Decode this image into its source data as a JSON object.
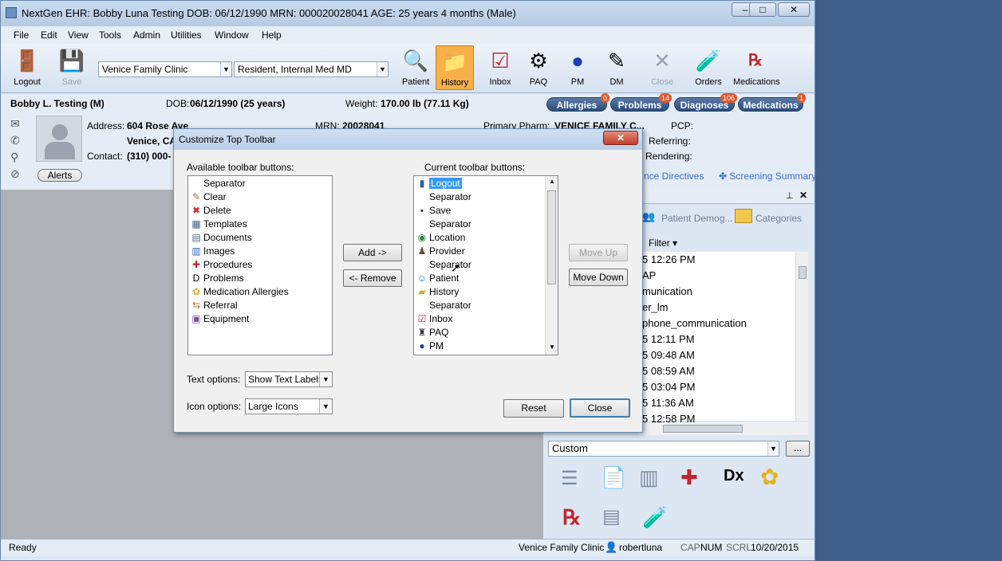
{
  "window": {
    "title": "NextGen EHR: Bobby Luna Testing  DOB: 06/12/1990  MRN: 000020028041  AGE: 25 years 4 months  (Male)",
    "controls": [
      "–",
      "□",
      "✕"
    ]
  },
  "menu": [
    "File",
    "Edit",
    "View",
    "Tools",
    "Admin",
    "Utilities",
    "Window",
    "Help"
  ],
  "toolbar": {
    "logout": "Logout",
    "save": "Save",
    "location_value": "Venice Family Clinic",
    "provider_value": "Resident, Internal Med MD",
    "patient": "Patient",
    "history": "History",
    "inbox": "Inbox",
    "paq": "PAQ",
    "pm": "PM",
    "dm": "DM",
    "close": "Close",
    "orders": "Orders",
    "medications": "Medications"
  },
  "patient": {
    "name": "Bobby L. Testing  (M)",
    "dob_label": "DOB:",
    "dob_value": "06/12/1990 (25 years)",
    "weight_label": "Weight:",
    "weight_value": "170.00 lb (77.11 Kg)",
    "address_label": "Address:",
    "address_value": "604 Rose Ave",
    "city_value": "Venice, CA",
    "contact_label": "Contact:",
    "contact_value": "(310) 000-",
    "mrn_label": "MRN:",
    "mrn_value": "20028041",
    "pharm_label": "Primary Pharm:",
    "pharm_value": "VENICE FAMILY C...",
    "pcp_label": "PCP:",
    "referring_label": "Referring:",
    "rendering_label": "Rendering:",
    "alerts": "Alerts"
  },
  "pills": [
    {
      "label": "Allergies",
      "badge": "0"
    },
    {
      "label": "Problems",
      "badge": "14"
    },
    {
      "label": "Diagnoses",
      "badge": "106"
    },
    {
      "label": "Medications",
      "badge": "1"
    }
  ],
  "right_panel": {
    "links": [
      "nce Directives",
      "Screening Summary"
    ],
    "tabs": [
      "Patient Demog...",
      "Categories"
    ],
    "filter": "Filter",
    "list": [
      "5 12:26 PM",
      "AP",
      "munication",
      "er_lm",
      "phone_communication",
      "5 12:11 PM",
      "5 09:48 AM",
      "5 08:59 AM",
      "5 03:04 PM",
      "5 11:36 AM",
      "5 12:58 PM"
    ],
    "custom": "Custom",
    "more": "..."
  },
  "dialog": {
    "title": "Customize Top Toolbar",
    "close": "✕",
    "available_label": "Available toolbar buttons:",
    "current_label": "Current toolbar buttons:",
    "available": [
      {
        "icon": "",
        "label": "Separator"
      },
      {
        "icon": "eraser-icon",
        "label": "Clear"
      },
      {
        "icon": "x-icon",
        "label": "Delete"
      },
      {
        "icon": "table-icon",
        "label": "Templates"
      },
      {
        "icon": "document-icon",
        "label": "Documents"
      },
      {
        "icon": "images-icon",
        "label": "Images"
      },
      {
        "icon": "procedures-icon",
        "label": "Procedures"
      },
      {
        "icon": "dx-icon",
        "label": "Problems"
      },
      {
        "icon": "flower-icon",
        "label": "Medication Allergies"
      },
      {
        "icon": "referral-icon",
        "label": "Referral"
      },
      {
        "icon": "equipment-icon",
        "label": "Equipment"
      }
    ],
    "current": [
      {
        "icon": "logout-icon",
        "label": "Logout",
        "selected": true
      },
      {
        "icon": "",
        "label": "Separator"
      },
      {
        "icon": "floppy-icon",
        "label": "Save"
      },
      {
        "icon": "",
        "label": "Separator"
      },
      {
        "icon": "globe-icon",
        "label": "Location"
      },
      {
        "icon": "doctor-icon",
        "label": "Provider"
      },
      {
        "icon": "",
        "label": "Separator"
      },
      {
        "icon": "patient-icon",
        "label": "Patient"
      },
      {
        "icon": "history-icon",
        "label": "History"
      },
      {
        "icon": "",
        "label": "Separator"
      },
      {
        "icon": "check-icon",
        "label": "Inbox"
      },
      {
        "icon": "stamp-icon",
        "label": "PAQ"
      },
      {
        "icon": "pm-icon",
        "label": "PM"
      }
    ],
    "add": "Add ->",
    "remove": "<- Remove",
    "move_up": "Move Up",
    "move_down": "Move Down",
    "text_options_label": "Text options:",
    "text_options_value": "Show Text Labels",
    "icon_options_label": "Icon options:",
    "icon_options_value": "Large Icons",
    "reset": "Reset",
    "close_button": "Close"
  },
  "status": {
    "ready": "Ready",
    "location": "Venice Family Clinic",
    "user": "robertluna",
    "cap": "CAP",
    "num": "NUM",
    "scrl": "SCRL",
    "date": "10/20/2015"
  }
}
